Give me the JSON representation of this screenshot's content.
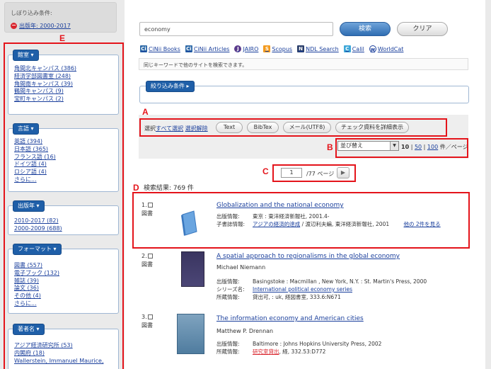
{
  "sidebar": {
    "conditions_title": "しぼり込み条件:",
    "active_condition": "出版年: 2000-2017",
    "facets": [
      {
        "label": "館室",
        "items": [
          "角間北キャンパス (386)",
          "経済学部図書室 (248)",
          "角間南キャンパス (39)",
          "鶴間キャンパス (9)",
          "宝町キャンパス (2)"
        ]
      },
      {
        "label": "言語",
        "items": [
          "英語 (394)",
          "日本語 (365)",
          "フランス語 (16)",
          "ドイツ語 (4)",
          "ロシア語 (4)",
          "さらに..."
        ]
      },
      {
        "label": "出版年",
        "items": [
          "2010-2017 (82)",
          "2000-2009 (688)"
        ]
      },
      {
        "label": "フォーマット",
        "items": [
          "図書 (557)",
          "電子ブック (132)",
          "雑誌 (39)",
          "論文 (36)",
          "その他 (4)",
          "さらに..."
        ]
      },
      {
        "label": "著者名",
        "items": [
          "アジア経済研究所 (53)",
          "内閣府 (18)",
          "Wallerstein, Immanuel Maurice,"
        ]
      }
    ]
  },
  "search": {
    "query": "economy",
    "search_label": "検索",
    "clear_label": "クリア",
    "external_links": [
      "CiNii Books",
      "CiNii Articles",
      "JAIRO",
      "Scopus",
      "NDL Search",
      "Calil",
      "WorldCat"
    ],
    "note": "同じキーワードで他のサイトを検索できます。",
    "narrow_label": "絞り込み条件"
  },
  "toolbar": {
    "select_label": "選択",
    "select_all": "すべて選択",
    "deselect": "選択解除",
    "buttons": [
      "Text",
      "BibTex",
      "メール(UTF8)",
      "チェック資料を詳細表示"
    ],
    "sort_label": "並び替え",
    "per_page_current": "10",
    "per_page_sep1": "|",
    "per_page_50": "50",
    "per_page_sep2": "|",
    "per_page_100": "100",
    "per_page_unit": "件／ページ"
  },
  "pager": {
    "current": "1",
    "total_text": "/77 ページ",
    "next_icon": "▶"
  },
  "results": {
    "count_text": "検索結果: 769 件",
    "records": [
      {
        "num": "1.",
        "type": "図書",
        "title": "Globalization and the national economy",
        "author": "",
        "pub_key": "出版情報:",
        "pub_val": "東京 : 東洋経済新報社, 2001.4-",
        "extra_key": "子書誌情報:",
        "extra_link": "アジアの経済的達成",
        "extra_rest": "/ 渡辺利夫編, 東洋経済新報社, 2001",
        "extra_more": "他の 2件を見る"
      },
      {
        "num": "2.",
        "type": "図書",
        "title": "A spatial approach to regionalisms in the global economy",
        "author": "Michael Niemann",
        "pub_key": "出版情報:",
        "pub_val": "Basingstoke : Macmillan , New York, N.Y. : St. Martin's Press, 2000",
        "series_key": "シリーズ名:",
        "series_val": "International political economy series",
        "hold_key": "所蔵情報:",
        "hold_red": "",
        "hold_val": "貸出可, : uk, 経図書室, 333.6:N671"
      },
      {
        "num": "3.",
        "type": "図書",
        "title": "The information economy and American cities",
        "author": "Matthew P. Drennan",
        "pub_key": "出版情報:",
        "pub_val": "Baltimore : Johns Hopkins University Press, 2002",
        "hold_key": "所蔵情報:",
        "hold_red": "研究室貸出",
        "hold_val": ", 経, 332.53:D772"
      }
    ]
  },
  "annotations": [
    "A",
    "B",
    "C",
    "D",
    "E"
  ]
}
